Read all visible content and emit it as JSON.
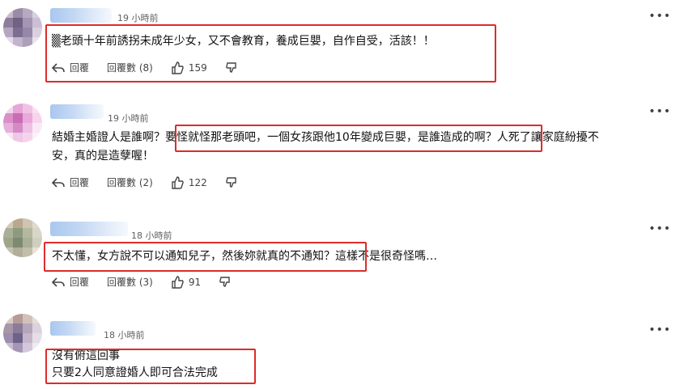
{
  "comments": [
    {
      "time": "19 小時前",
      "text": "▒老頭十年前誘拐未成年少女，又不會教育，養成巨嬰，自作自受，活該！！",
      "reply_label": "回覆",
      "replies_label": "回覆數 (8)",
      "likes": "159",
      "more": "•••",
      "avatar_colors": [
        "#9a8ba6",
        "#b7a9c0",
        "#d7d0de",
        "#c9b9cf"
      ]
    },
    {
      "time": "19 小時前",
      "text_line1": "結婚主婚證人是誰啊？要怪就怪那老頭吧，一個女孩跟他10年變成巨嬰，是誰造成的啊？人死了讓家庭紛擾不",
      "text_line2": "安，真的是造孽喔！",
      "reply_label": "回覆",
      "replies_label": "回覆數 (2)",
      "likes": "122",
      "more": "•••",
      "avatar_colors": [
        "#e6a6d6",
        "#f0c3e5",
        "#f8e0f2",
        "#d98fc8"
      ]
    },
    {
      "time": "18 小時前",
      "text": "不太懂，女方說不可以通知兒子，然後妳就真的不通知？這樣不是很奇怪嗎…",
      "reply_label": "回覆",
      "replies_label": "回覆數 (3)",
      "likes": "91",
      "more": "•••",
      "avatar_colors": [
        "#b9a88e",
        "#cfc3b1",
        "#8e9a7f",
        "#a8b096"
      ]
    },
    {
      "time": "18 小時前",
      "text_line1": "沒有俯這回事",
      "text_line2": "只要2人同意證婚人即可合法完成",
      "more": "•••",
      "avatar_colors": [
        "#b59c96",
        "#d2c1ba",
        "#8a7b9b",
        "#c5b5c8"
      ]
    }
  ],
  "highlight_color": "#dd2b2b"
}
